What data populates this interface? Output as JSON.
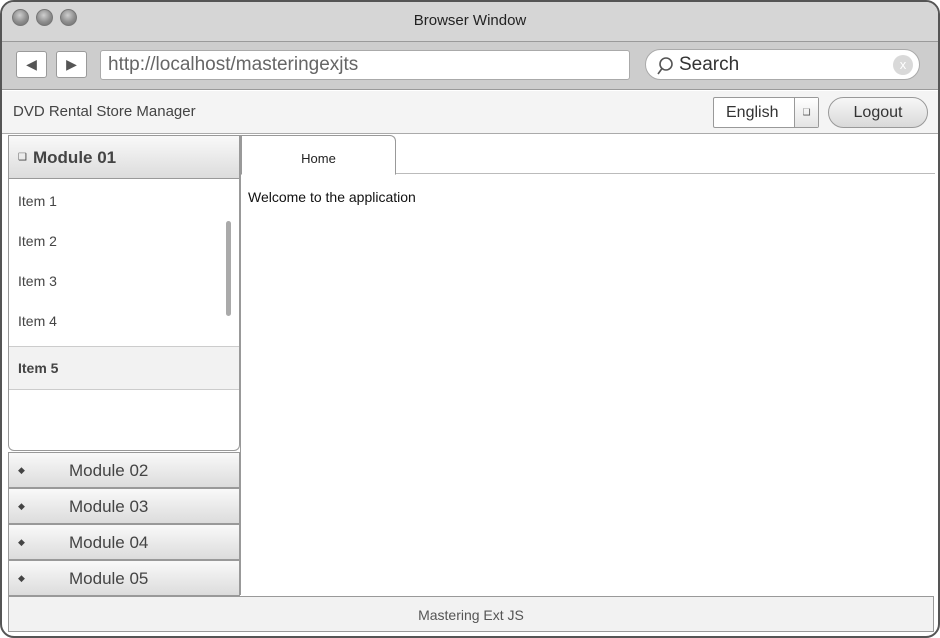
{
  "window": {
    "title": "Browser Window"
  },
  "browser": {
    "back_icon": "◀",
    "forward_icon": "▶",
    "url": "http://localhost/masteringexjts",
    "search_placeholder": "Search",
    "search_clear": "x"
  },
  "app": {
    "title": "DVD Rental Store Manager",
    "language": "English",
    "logout_label": "Logout"
  },
  "sidebar": {
    "active_module": {
      "icon": "❑",
      "label": "Module 01"
    },
    "items": [
      "Item 1",
      "Item 2",
      "Item 3",
      "Item 4",
      "Item 5"
    ],
    "selected_item": "Item 5",
    "modules": [
      {
        "icon": "◆",
        "label": "Module 02"
      },
      {
        "icon": "◆",
        "label": "Module 03"
      },
      {
        "icon": "◆",
        "label": "Module 04"
      },
      {
        "icon": "◆",
        "label": "Module 05"
      }
    ]
  },
  "main": {
    "tabs": [
      {
        "label": "Home"
      }
    ],
    "content": "Welcome to the application"
  },
  "footer": {
    "text": "Mastering Ext JS"
  }
}
